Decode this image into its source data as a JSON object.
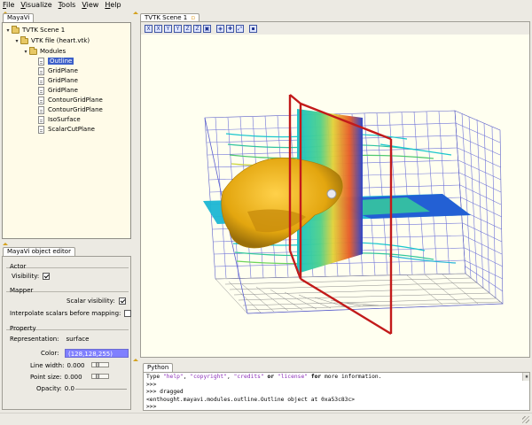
{
  "menu": [
    "File",
    "Visualize",
    "Tools",
    "View",
    "Help"
  ],
  "tree": {
    "tab": "MayaVi",
    "root": "TVTK Scene 1",
    "vtk_file": "VTK file (heart.vtk)",
    "modules_label": "Modules",
    "modules": [
      "Outline",
      "GridPlane",
      "GridPlane",
      "GridPlane",
      "ContourGridPlane",
      "ContourGridPlane",
      "IsoSurface",
      "ScalarCutPlane"
    ],
    "selected": "Outline"
  },
  "editor": {
    "tab": "MayaVi object editor",
    "actor_label": "Actor",
    "visibility_label": "Visibility:",
    "visibility": true,
    "mapper_label": "Mapper",
    "scalar_visibility_label": "Scalar visibility:",
    "scalar_visibility": true,
    "interpolate_label": "Interpolate scalars before mapping:",
    "interpolate": false,
    "property_label": "Property",
    "representation_label": "Representation:",
    "representation_value": "surface",
    "color_label": "Color:",
    "color_value": "(128,128,255)",
    "color_hex": "#8080ff",
    "line_width_label": "Line width:",
    "line_width_value": "0.000",
    "point_size_label": "Point size:",
    "point_size_value": "0.000",
    "opacity_label": "Opacity:",
    "opacity_value": "0.0"
  },
  "scene": {
    "tab": "TVTK Scene 1",
    "toolbar_icons": [
      "view-x-icon",
      "view-neg-x-icon",
      "view-y-icon",
      "view-neg-y-icon",
      "view-z-icon",
      "view-neg-z-icon",
      "isometric-icon",
      "parallel-projection-icon",
      "axes-icon",
      "fullscreen-icon",
      "save-icon"
    ],
    "toolbar_glyphs": [
      "X",
      "X",
      "Y",
      "Y",
      "Z",
      "Z",
      "▣",
      "◈",
      "✚",
      "⤢",
      "▪"
    ]
  },
  "python": {
    "tab": "Python",
    "line1_a": "Type ",
    "line1_help": "\"help\"",
    "line1_b": ", ",
    "line1_copyright": "\"copyright\"",
    "line1_c": ", ",
    "line1_credits": "\"credits\"",
    "line1_or": " or ",
    "line1_license": "\"license\"",
    "line1_for": " for",
    "line1_d": " more information.",
    "prompt": ">>>",
    "line3": ">>> dragged",
    "line4": "<enthought.mayavi.modules.outline.Outline object at 0xa53c83c>",
    "line5": ">>>"
  }
}
